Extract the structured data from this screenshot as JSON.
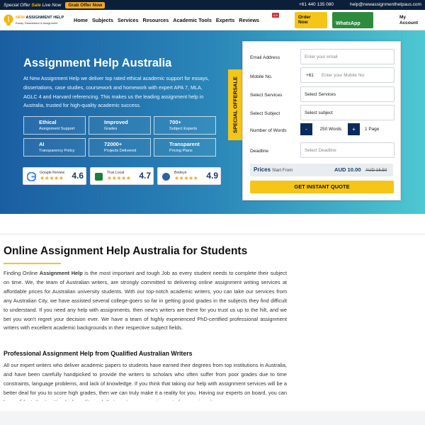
{
  "topbar": {
    "offer_prefix": "Special Offer ",
    "offer_highlight": "Sale",
    "offer_suffix": " Live Now",
    "grab_label": "Grab Offer Now",
    "phone": "+61 440 135 080",
    "email": "help@newassignmenthelpaus.com"
  },
  "nav": {
    "logo_name_1": "NEW ",
    "logo_name_2": "ASSIGNMENT HELP",
    "logo_tagline": "Essay, Dissertation & Assignment",
    "items": [
      "Home",
      "Subjects",
      "Services",
      "Resources",
      "Academic Tools",
      "Experts",
      "Reviews"
    ],
    "reviews_badge": "4.9",
    "order_label_1": "Order",
    "order_label_2": "Now",
    "whatsapp_label": "WhatsApp",
    "account_1": "My",
    "account_2": "Account"
  },
  "hero": {
    "title": "Assignment Help Australia",
    "intro": "At New Assignment Help we deliver top rated ethical academic support for essays, dissertations, case studies, coursework and homework with expert APA 7, MLA, AGLC 4 and Harvard referencing. This makes us the leading assignment help in Australia, trusted for high-quality academic success.",
    "features": [
      {
        "title": "Ethical",
        "sub": "Assignment Support"
      },
      {
        "title": "Improved",
        "sub": "Grades"
      },
      {
        "title": "700+",
        "sub": "Subject Experts"
      },
      {
        "title": "AI",
        "sub": "Transparency Policy"
      },
      {
        "title": "72000+",
        "sub": "Projects Delivered"
      },
      {
        "title": "Transparent",
        "sub": "Pricing Plans"
      }
    ],
    "reviews": [
      {
        "source": "Google Review",
        "score": "4.6",
        "stars": "★★★★★"
      },
      {
        "source": "True Local",
        "score": "4.7",
        "stars": "★★★★★"
      },
      {
        "source": "Birdeye",
        "score": "4.9",
        "stars": "★★★★★"
      }
    ],
    "offer_tab": "SPECIAL OFFERSALE"
  },
  "form": {
    "email_label": "Email Address",
    "email_placeholder": "Enter your email",
    "mobile_label": "Mobile No.",
    "country_code": "+61",
    "mobile_placeholder": "Enter your Mobile No",
    "services_label": "Select Services",
    "services_value": "Select Services",
    "subject_label": "Select Subject",
    "subject_value": "Select subject",
    "words_label": "Number of Words",
    "minus": "-",
    "words_value": "250 Words",
    "plus": "+",
    "pages_value": "1 Page",
    "deadline_label": "Deadline",
    "deadline_placeholder": "Select Deadline",
    "price_label": "Prices",
    "price_from": "Start From",
    "price_now": "AUD 10.00",
    "price_old": "AUD 16.50",
    "quote_label": "GET INSTANT QUOTE"
  },
  "content": {
    "heading": "Online Assignment Help Australia for Students",
    "para1_pre": "Finding Online ",
    "para1_bold": "Assignment Help",
    "para1_post": " is the most important and tough Job as every student needs to complete their subject on time. We, the team of Australian writers, are strongly committed to delivering online assignment writing services at affordable prices for Australian university students. With our top-notch academic writers, you can take our services from any Australian City, we have assisted several college-goers so far in getting good grades in the subjects they find difficult to understand. If you need any help with assignments, then new's writers are there for you trust us up to the hilt, and we bet you won't regret your decision ever. We have a team of highly experienced PhD-certified professional assignment writers with excellent academic backgrounds in their respective subject fields.",
    "subheading": "Professional Assignment Help from Qualified Australian Writers",
    "para2": "All our expert writers who deliver academic papers to students have earned their degrees from top institutions in Australia, and have been carefully handpicked to provide the writers to scholars who often suffer from poor grades due to time constraints, language problems, and lack of knowledge. If you think that taking our help with assignment services will be a better deal for you to score high grades, then we can truly make it a reality for you. Having our experts on board, you can be confident about getting high-quality work that meets every requirement of your university."
  },
  "colors": {
    "navy": "#0b1f3a",
    "accent_yellow": "#f5c518",
    "whatsapp_green": "#2e8b3e",
    "hero_start": "#1a5ea2",
    "hero_end": "#4ec8d2"
  }
}
